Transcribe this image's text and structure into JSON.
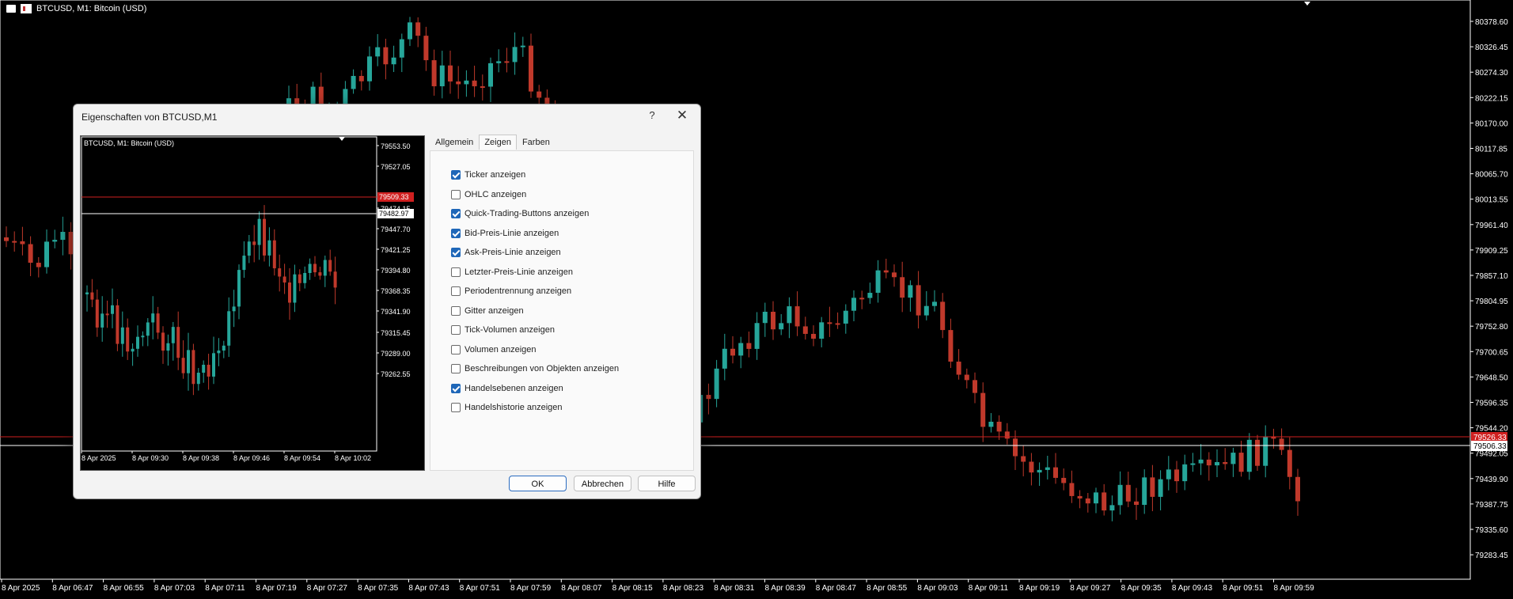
{
  "main": {
    "title": "BTCUSD, M1:  Bitcoin (USD)",
    "bid_label": "79526.33",
    "ask_label": "79506.33",
    "price_ticks": [
      "80378.60",
      "80326.45",
      "80274.30",
      "80222.15",
      "80170.00",
      "80117.85",
      "80065.70",
      "80013.55",
      "79961.40",
      "79909.25",
      "79857.10",
      "79804.95",
      "79752.80",
      "79700.65",
      "79648.50",
      "79596.35",
      "79544.20",
      "79492.05",
      "79439.90",
      "79387.75",
      "79335.60",
      "79283.45"
    ],
    "time_ticks": [
      "8 Apr 2025",
      "8 Apr 06:47",
      "8 Apr 06:55",
      "8 Apr 07:03",
      "8 Apr 07:11",
      "8 Apr 07:19",
      "8 Apr 07:27",
      "8 Apr 07:35",
      "8 Apr 07:43",
      "8 Apr 07:51",
      "8 Apr 07:59",
      "8 Apr 08:07",
      "8 Apr 08:15",
      "8 Apr 08:23",
      "8 Apr 08:31",
      "8 Apr 08:39",
      "8 Apr 08:47",
      "8 Apr 08:55",
      "8 Apr 09:03",
      "8 Apr 09:11",
      "8 Apr 09:19",
      "8 Apr 09:27",
      "8 Apr 09:35",
      "8 Apr 09:43",
      "8 Apr 09:51",
      "8 Apr 09:59"
    ]
  },
  "dialog": {
    "title": "Eigenschaften von BTCUSD,M1",
    "help": "?",
    "close": "✕",
    "tabs": [
      {
        "label": "Allgemein",
        "active": false
      },
      {
        "label": "Zeigen",
        "active": true
      },
      {
        "label": "Farben",
        "active": false
      }
    ],
    "options": [
      {
        "label": "Ticker anzeigen",
        "checked": true
      },
      {
        "label": "OHLC anzeigen",
        "checked": false
      },
      {
        "label": "Quick-Trading-Buttons anzeigen",
        "checked": true
      },
      {
        "label": "Bid-Preis-Linie anzeigen",
        "checked": true
      },
      {
        "label": "Ask-Preis-Linie anzeigen",
        "checked": true
      },
      {
        "label": "Letzter-Preis-Linie anzeigen",
        "checked": false
      },
      {
        "label": "Periodentrennung anzeigen",
        "checked": false
      },
      {
        "label": "Gitter anzeigen",
        "checked": false
      },
      {
        "label": "Tick-Volumen anzeigen",
        "checked": false
      },
      {
        "label": "Volumen anzeigen",
        "checked": false
      },
      {
        "label": "Beschreibungen von Objekten anzeigen",
        "checked": false
      },
      {
        "label": "Handelsebenen anzeigen",
        "checked": true
      },
      {
        "label": "Handelshistorie anzeigen",
        "checked": false
      }
    ],
    "buttons": {
      "ok": "OK",
      "cancel": "Abbrechen",
      "help": "Hilfe"
    },
    "preview": {
      "title": "BTCUSD, M1:  Bitcoin (USD)",
      "bid_label": "79509.33",
      "ask_label": "79482.97",
      "price_ticks": [
        "79553.50",
        "79527.05",
        "79474.15",
        "79447.70",
        "79421.25",
        "79394.80",
        "79368.35",
        "79341.90",
        "79315.45",
        "79289.00",
        "79262.55"
      ],
      "time_ticks": [
        "8 Apr 2025",
        "8 Apr 09:30",
        "8 Apr 09:38",
        "8 Apr 09:46",
        "8 Apr 09:54",
        "8 Apr 10:02"
      ]
    }
  },
  "colors": {
    "bull": "#26a69a",
    "bear": "#c0392b",
    "bid_line": "#d02020",
    "ask_line": "#ffffff",
    "background": "#000000"
  }
}
